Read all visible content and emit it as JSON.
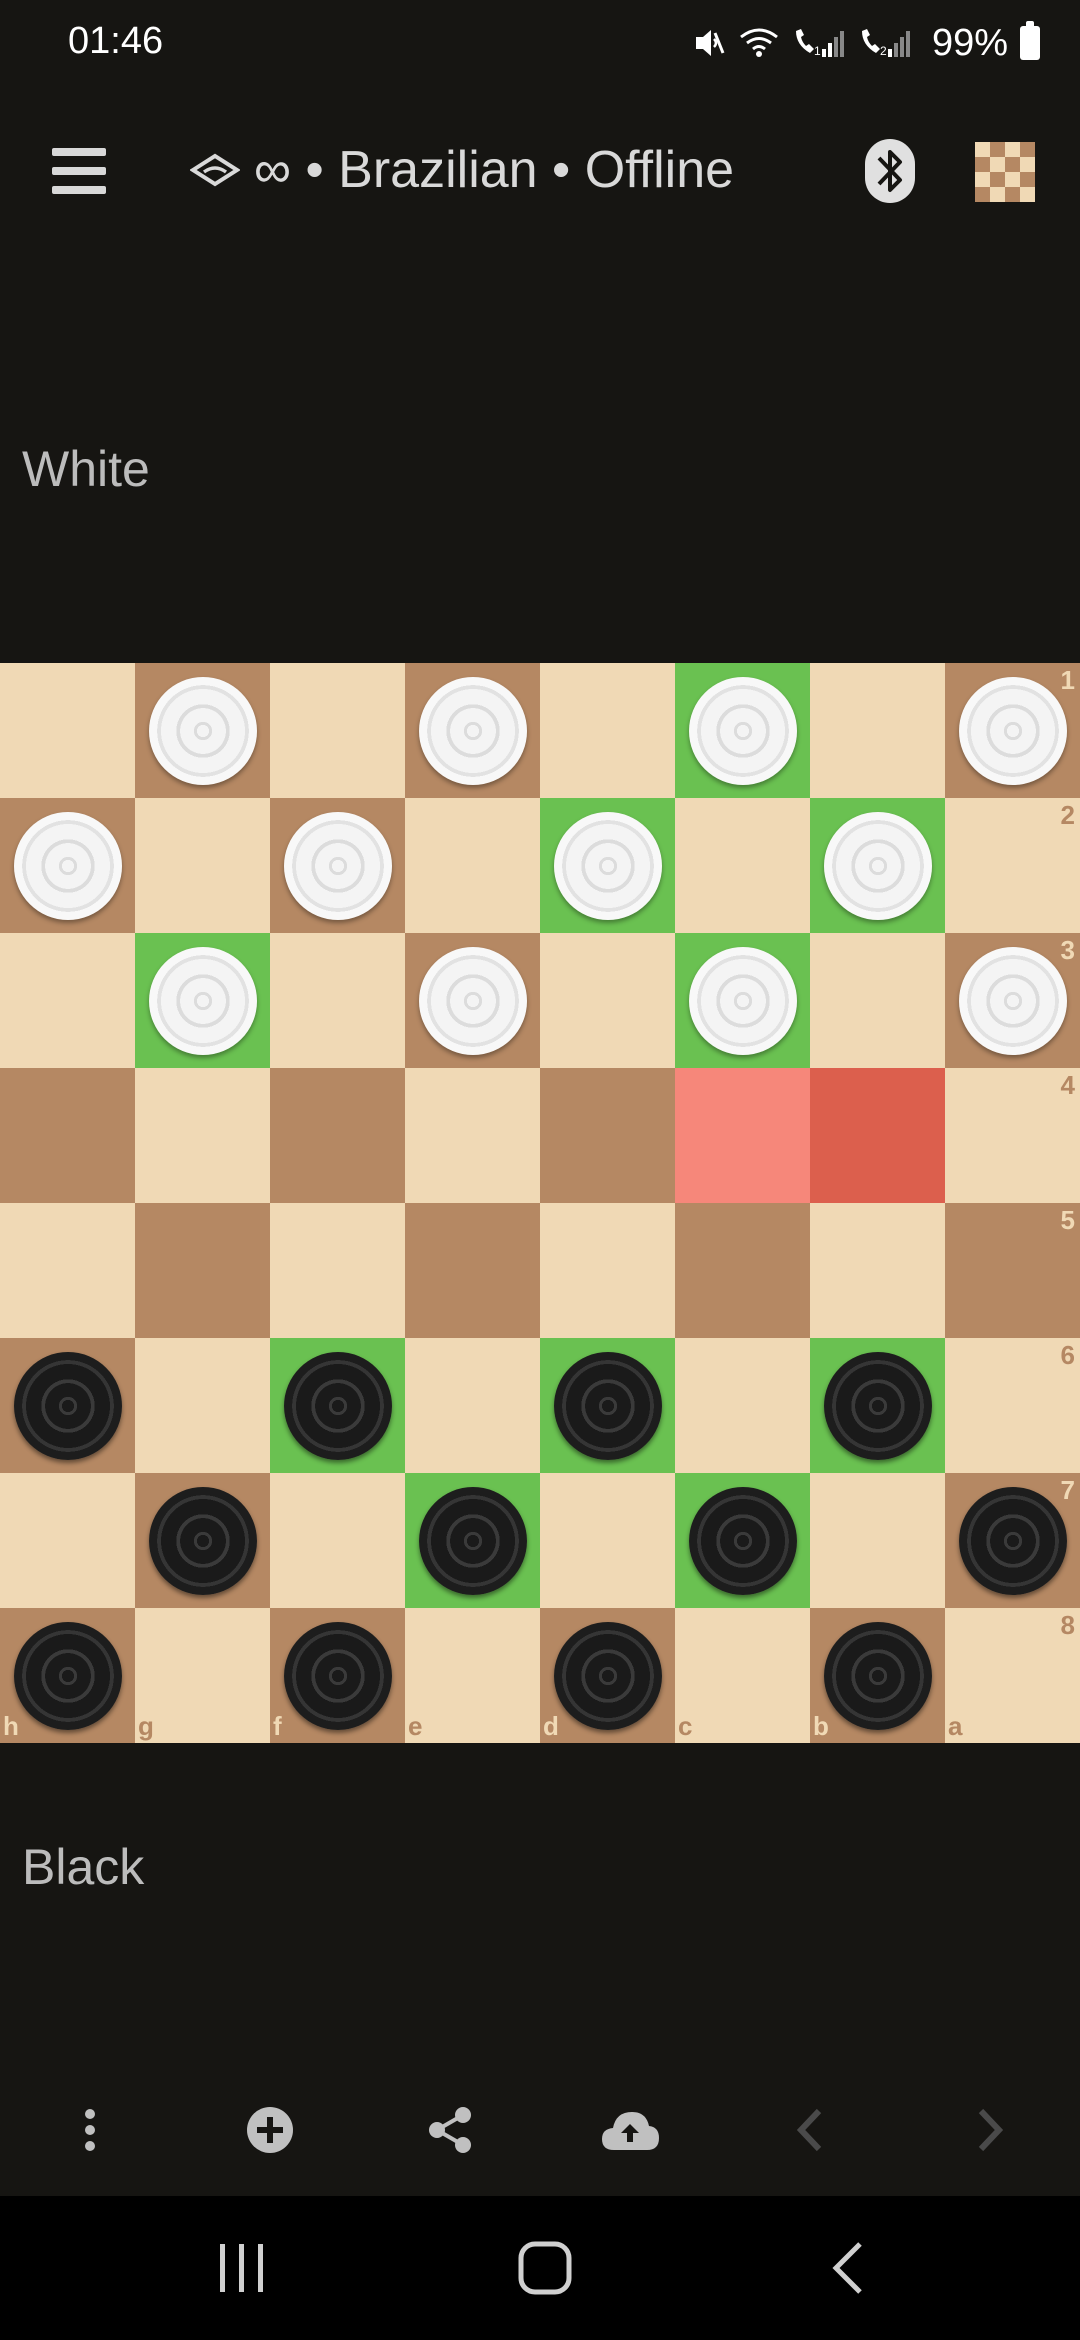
{
  "status_bar": {
    "time": "01:46",
    "battery_text": "99%",
    "icons": [
      "mute-icon",
      "wifi-calling-icon",
      "sim1-signal-icon",
      "sim2-signal-icon",
      "battery-icon"
    ]
  },
  "top_bar": {
    "menu_icon": "hamburger-icon",
    "variant_icon": "brazilian-flag-icon",
    "time_control": "∞",
    "title": "∞ • Brazilian • Offline",
    "bluetooth_icon": "bluetooth-icon",
    "board_icon": "checkerboard-icon"
  },
  "players": {
    "top": "White",
    "bottom": "Black"
  },
  "board": {
    "files": [
      "h",
      "g",
      "f",
      "e",
      "d",
      "c",
      "b",
      "a"
    ],
    "ranks": [
      "1",
      "2",
      "3",
      "4",
      "5",
      "6",
      "7",
      "8"
    ],
    "white_pieces": [
      "g1",
      "e1",
      "c1",
      "a1",
      "h2",
      "f2",
      "d2",
      "b2",
      "g3",
      "e3",
      "c3",
      "a3"
    ],
    "black_pieces": [
      "h6",
      "f6",
      "d6",
      "b6",
      "g7",
      "e7",
      "c7",
      "a7",
      "h8",
      "f8",
      "d8",
      "b8"
    ],
    "movable_squares": [
      "c1",
      "d2",
      "b2",
      "g3",
      "c3",
      "f6",
      "d6",
      "b6",
      "e7",
      "c7"
    ],
    "last_move": {
      "from": "c4",
      "to": "b4"
    },
    "colors": {
      "light": "#f0d9b5",
      "dark": "#b58863",
      "movable": "#6ac151",
      "last_from": "#f6877a",
      "last_to": "#dc5f4d"
    }
  },
  "bottom_bar": {
    "buttons": [
      "more-vertical-icon",
      "add-circle-icon",
      "share-icon",
      "cloud-upload-icon",
      "chevron-left-icon",
      "chevron-right-icon"
    ]
  },
  "nav_bar": {
    "buttons": [
      "recents-icon",
      "home-icon",
      "back-icon"
    ]
  }
}
